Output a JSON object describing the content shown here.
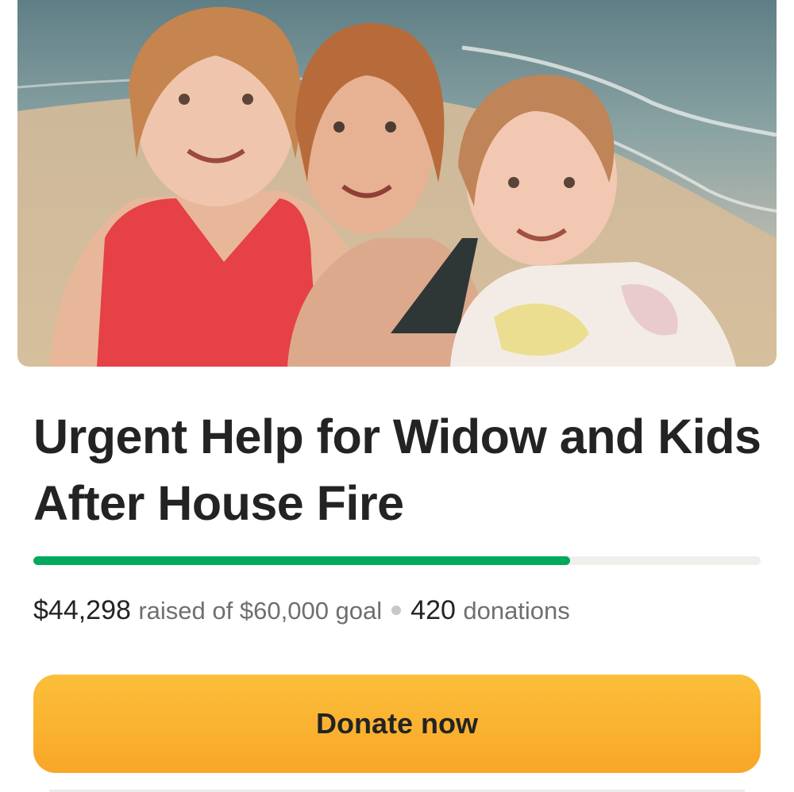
{
  "campaign": {
    "title": "Urgent Help for Widow and Kids After House Fire",
    "raised": "$44,298",
    "raised_suffix": "raised of $60,000 goal",
    "donation_count": "420",
    "donation_label": "donations",
    "progress_fraction": 0.738,
    "photo": "beach-photo-mother-and-two-daughters"
  },
  "actions": {
    "donate_label": "Donate now"
  },
  "colors": {
    "progress": "#02a95c",
    "donate_button": "#f9a628",
    "text": "#232323"
  }
}
